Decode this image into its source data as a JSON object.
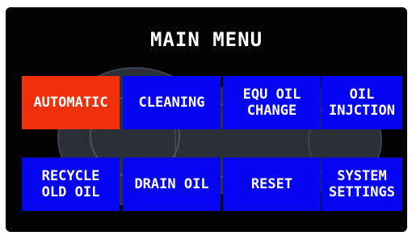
{
  "header": {
    "title": "MAIN MENU"
  },
  "menu": {
    "buttons": [
      {
        "label": "AUTOMATIC",
        "active": true
      },
      {
        "label": "CLEANING",
        "active": false
      },
      {
        "label": "EQU OIL\nCHANGE",
        "active": false
      },
      {
        "label": "OIL\nINJCTION",
        "active": false
      },
      {
        "label": "RECYCLE\nOLD OIL",
        "active": false
      },
      {
        "label": "DRAIN OIL",
        "active": false
      },
      {
        "label": "RESET",
        "active": false
      },
      {
        "label": "SYSTEM\nSETTINGS",
        "active": false
      }
    ]
  },
  "colors": {
    "screen_bg": "#030303",
    "button": "#0505f2",
    "button_active": "#f0300a",
    "text": "#ffffff"
  }
}
